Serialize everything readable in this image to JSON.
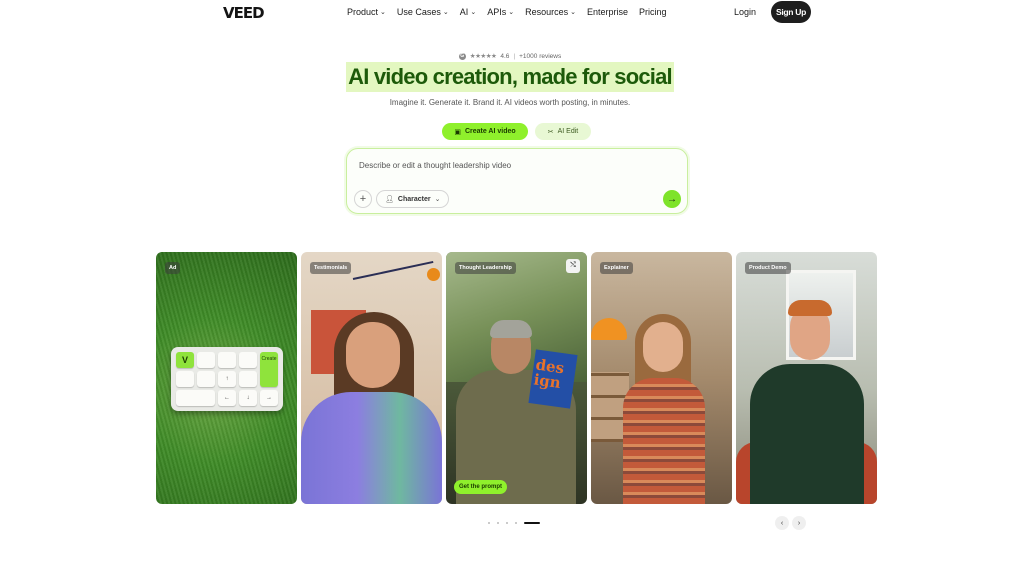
{
  "nav": {
    "logo": "VEED",
    "menu": [
      {
        "label": "Product",
        "chevron": true
      },
      {
        "label": "Use Cases",
        "chevron": true
      },
      {
        "label": "AI",
        "chevron": true
      },
      {
        "label": "APIs",
        "chevron": true
      },
      {
        "label": "Resources",
        "chevron": true
      },
      {
        "label": "Enterprise",
        "chevron": false
      },
      {
        "label": "Pricing",
        "chevron": false
      }
    ],
    "login": "Login",
    "signup": "Sign Up"
  },
  "hero": {
    "rating_score": "4.6",
    "rating_separator": "|",
    "rating_reviews": "+1000 reviews",
    "headline": "AI video creation, made for social",
    "subtitle": "Imagine it. Generate it. Brand it. AI videos worth posting, in minutes.",
    "create_button": "Create AI video",
    "edit_button": "AI Edit"
  },
  "prompt": {
    "placeholder": "Describe or edit a thought leadership video",
    "character_label": "Character"
  },
  "cards": [
    {
      "tag": "Ad",
      "keyboard_key_v": "V",
      "keyboard_key_create": "Create"
    },
    {
      "tag": "Testimonials"
    },
    {
      "tag": "Thought Leadership",
      "book_text": "des ign",
      "cta": "Get the prompt"
    },
    {
      "tag": "Explainer"
    },
    {
      "tag": "Product Demo"
    }
  ],
  "carousel": {
    "dot_count": 5,
    "active_dot": 4
  },
  "colors": {
    "accent_green": "#8ff02c",
    "headline_green": "#1d5a0a",
    "dark": "#1e1e1e"
  }
}
